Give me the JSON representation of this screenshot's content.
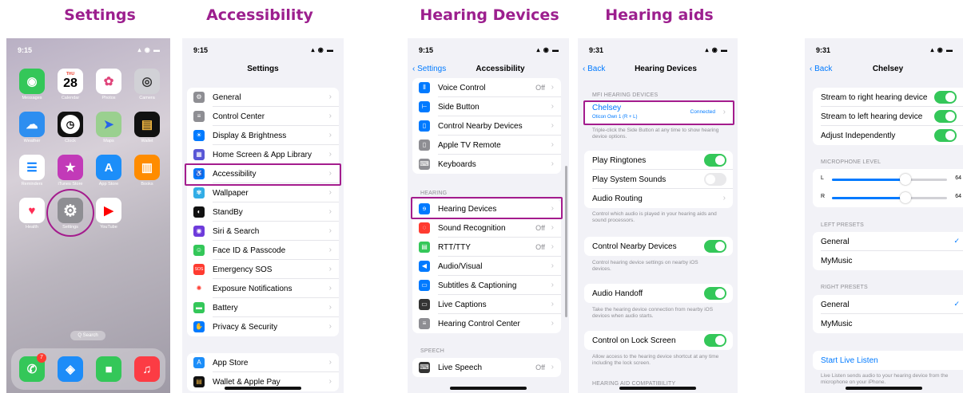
{
  "headings": [
    "Settings",
    "Accessibility",
    "Hearing Devices",
    "Hearing aids"
  ],
  "home": {
    "time": "9:15",
    "cal_day": "THU",
    "cal_date": "28",
    "apps": [
      "Messages",
      "Calendar",
      "Photos",
      "Camera",
      "Weather",
      "Clock",
      "Maps",
      "Wallet",
      "Reminders",
      "iTunes Store",
      "App Store",
      "Books",
      "Health",
      "Settings",
      "YouTube"
    ],
    "search": "Q Search",
    "badge": "7"
  },
  "settings": {
    "time": "9:15",
    "title": "Settings",
    "items": [
      "General",
      "Control Center",
      "Display & Brightness",
      "Home Screen & App Library",
      "Accessibility",
      "Wallpaper",
      "StandBy",
      "Siri & Search",
      "Face ID & Passcode",
      "Emergency SOS",
      "Exposure Notifications",
      "Battery",
      "Privacy & Security"
    ],
    "items2": [
      "App Store",
      "Wallet & Apple Pay"
    ]
  },
  "accessibility": {
    "time": "9:15",
    "back": "Settings",
    "title": "Accessibility",
    "rows1": [
      {
        "label": "Voice Control",
        "value": "Off"
      },
      {
        "label": "Side Button",
        "value": ""
      },
      {
        "label": "Control Nearby Devices",
        "value": ""
      },
      {
        "label": "Apple TV Remote",
        "value": ""
      },
      {
        "label": "Keyboards",
        "value": ""
      }
    ],
    "hearing_header": "HEARING",
    "rows2": [
      {
        "label": "Hearing Devices",
        "value": ""
      },
      {
        "label": "Sound Recognition",
        "value": "Off"
      },
      {
        "label": "RTT/TTY",
        "value": "Off"
      },
      {
        "label": "Audio/Visual",
        "value": ""
      },
      {
        "label": "Subtitles & Captioning",
        "value": ""
      },
      {
        "label": "Live Captions",
        "value": ""
      },
      {
        "label": "Hearing Control Center",
        "value": ""
      }
    ],
    "speech_header": "SPEECH",
    "live_speech": "Live Speech",
    "live_speech_value": "Off"
  },
  "hearing_devices": {
    "time": "9:31",
    "back": "Back",
    "title": "Hearing Devices",
    "mfi_header": "MFI HEARING DEVICES",
    "device_name": "Chelsey",
    "device_model": "Oticon Own 1 (R + L)",
    "device_status": "Connected",
    "triple_click_note": "Triple-click the Side Button at any time to show hearing device options.",
    "play_ringtones": "Play Ringtones",
    "play_system_sounds": "Play System Sounds",
    "audio_routing": "Audio Routing",
    "routing_note": "Control which audio is played in your hearing aids and sound processors.",
    "control_nearby": "Control Nearby Devices",
    "nearby_note": "Control hearing device settings on nearby iOS devices.",
    "audio_handoff": "Audio Handoff",
    "handoff_note": "Take the hearing device connection from nearby iOS devices when audio starts.",
    "lock_screen": "Control on Lock Screen",
    "lock_note": "Allow access to the hearing device shortcut at any time including the lock screen.",
    "compat_header": "HEARING AID COMPATIBILITY"
  },
  "chelsey": {
    "time": "9:31",
    "back": "Back",
    "title": "Chelsey",
    "stream_right": "Stream to right hearing device",
    "stream_left": "Stream to left hearing device",
    "adjust": "Adjust Independently",
    "mic_header": "MICROPHONE LEVEL",
    "left_label": "L",
    "left_value": "64",
    "left_level": 0.64,
    "right_label": "R",
    "right_value": "64",
    "right_level": 0.64,
    "left_presets_header": "LEFT PRESETS",
    "right_presets_header": "RIGHT PRESETS",
    "preset_general": "General",
    "preset_mymusic": "MyMusic",
    "check": "✓",
    "live_listen": "Start Live Listen",
    "live_listen_note": "Live Listen sends audio to your hearing device from the microphone on your iPhone."
  }
}
